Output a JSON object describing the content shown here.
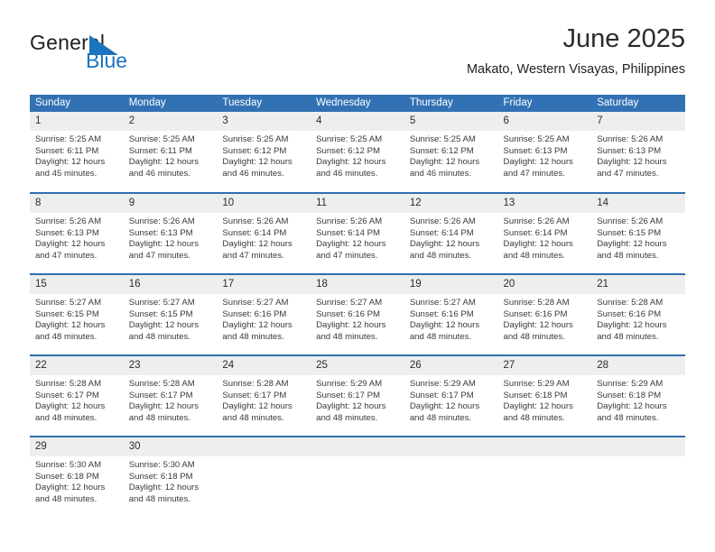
{
  "logo": {
    "text_primary": "General",
    "text_secondary": "Blue",
    "triangle_color": "#1e73be",
    "primary_color": "#231f20",
    "secondary_color": "#1e73be"
  },
  "header": {
    "title": "June 2025",
    "subtitle": "Makato, Western Visayas, Philippines"
  },
  "theme": {
    "header_blue": "#3272b4",
    "separator_blue": "#2f6fae",
    "day_band_gray": "#eeeeee",
    "text_dark": "#2b2b2b",
    "text_body": "#3a3a3a"
  },
  "calendar": {
    "weekday_headers": [
      "Sunday",
      "Monday",
      "Tuesday",
      "Wednesday",
      "Thursday",
      "Friday",
      "Saturday"
    ],
    "weeks": [
      [
        {
          "day": "1",
          "sunrise": "Sunrise: 5:25 AM",
          "sunset": "Sunset: 6:11 PM",
          "daylight_line1": "Daylight: 12 hours",
          "daylight_line2": "and 45 minutes."
        },
        {
          "day": "2",
          "sunrise": "Sunrise: 5:25 AM",
          "sunset": "Sunset: 6:11 PM",
          "daylight_line1": "Daylight: 12 hours",
          "daylight_line2": "and 46 minutes."
        },
        {
          "day": "3",
          "sunrise": "Sunrise: 5:25 AM",
          "sunset": "Sunset: 6:12 PM",
          "daylight_line1": "Daylight: 12 hours",
          "daylight_line2": "and 46 minutes."
        },
        {
          "day": "4",
          "sunrise": "Sunrise: 5:25 AM",
          "sunset": "Sunset: 6:12 PM",
          "daylight_line1": "Daylight: 12 hours",
          "daylight_line2": "and 46 minutes."
        },
        {
          "day": "5",
          "sunrise": "Sunrise: 5:25 AM",
          "sunset": "Sunset: 6:12 PM",
          "daylight_line1": "Daylight: 12 hours",
          "daylight_line2": "and 46 minutes."
        },
        {
          "day": "6",
          "sunrise": "Sunrise: 5:25 AM",
          "sunset": "Sunset: 6:13 PM",
          "daylight_line1": "Daylight: 12 hours",
          "daylight_line2": "and 47 minutes."
        },
        {
          "day": "7",
          "sunrise": "Sunrise: 5:26 AM",
          "sunset": "Sunset: 6:13 PM",
          "daylight_line1": "Daylight: 12 hours",
          "daylight_line2": "and 47 minutes."
        }
      ],
      [
        {
          "day": "8",
          "sunrise": "Sunrise: 5:26 AM",
          "sunset": "Sunset: 6:13 PM",
          "daylight_line1": "Daylight: 12 hours",
          "daylight_line2": "and 47 minutes."
        },
        {
          "day": "9",
          "sunrise": "Sunrise: 5:26 AM",
          "sunset": "Sunset: 6:13 PM",
          "daylight_line1": "Daylight: 12 hours",
          "daylight_line2": "and 47 minutes."
        },
        {
          "day": "10",
          "sunrise": "Sunrise: 5:26 AM",
          "sunset": "Sunset: 6:14 PM",
          "daylight_line1": "Daylight: 12 hours",
          "daylight_line2": "and 47 minutes."
        },
        {
          "day": "11",
          "sunrise": "Sunrise: 5:26 AM",
          "sunset": "Sunset: 6:14 PM",
          "daylight_line1": "Daylight: 12 hours",
          "daylight_line2": "and 47 minutes."
        },
        {
          "day": "12",
          "sunrise": "Sunrise: 5:26 AM",
          "sunset": "Sunset: 6:14 PM",
          "daylight_line1": "Daylight: 12 hours",
          "daylight_line2": "and 48 minutes."
        },
        {
          "day": "13",
          "sunrise": "Sunrise: 5:26 AM",
          "sunset": "Sunset: 6:14 PM",
          "daylight_line1": "Daylight: 12 hours",
          "daylight_line2": "and 48 minutes."
        },
        {
          "day": "14",
          "sunrise": "Sunrise: 5:26 AM",
          "sunset": "Sunset: 6:15 PM",
          "daylight_line1": "Daylight: 12 hours",
          "daylight_line2": "and 48 minutes."
        }
      ],
      [
        {
          "day": "15",
          "sunrise": "Sunrise: 5:27 AM",
          "sunset": "Sunset: 6:15 PM",
          "daylight_line1": "Daylight: 12 hours",
          "daylight_line2": "and 48 minutes."
        },
        {
          "day": "16",
          "sunrise": "Sunrise: 5:27 AM",
          "sunset": "Sunset: 6:15 PM",
          "daylight_line1": "Daylight: 12 hours",
          "daylight_line2": "and 48 minutes."
        },
        {
          "day": "17",
          "sunrise": "Sunrise: 5:27 AM",
          "sunset": "Sunset: 6:16 PM",
          "daylight_line1": "Daylight: 12 hours",
          "daylight_line2": "and 48 minutes."
        },
        {
          "day": "18",
          "sunrise": "Sunrise: 5:27 AM",
          "sunset": "Sunset: 6:16 PM",
          "daylight_line1": "Daylight: 12 hours",
          "daylight_line2": "and 48 minutes."
        },
        {
          "day": "19",
          "sunrise": "Sunrise: 5:27 AM",
          "sunset": "Sunset: 6:16 PM",
          "daylight_line1": "Daylight: 12 hours",
          "daylight_line2": "and 48 minutes."
        },
        {
          "day": "20",
          "sunrise": "Sunrise: 5:28 AM",
          "sunset": "Sunset: 6:16 PM",
          "daylight_line1": "Daylight: 12 hours",
          "daylight_line2": "and 48 minutes."
        },
        {
          "day": "21",
          "sunrise": "Sunrise: 5:28 AM",
          "sunset": "Sunset: 6:16 PM",
          "daylight_line1": "Daylight: 12 hours",
          "daylight_line2": "and 48 minutes."
        }
      ],
      [
        {
          "day": "22",
          "sunrise": "Sunrise: 5:28 AM",
          "sunset": "Sunset: 6:17 PM",
          "daylight_line1": "Daylight: 12 hours",
          "daylight_line2": "and 48 minutes."
        },
        {
          "day": "23",
          "sunrise": "Sunrise: 5:28 AM",
          "sunset": "Sunset: 6:17 PM",
          "daylight_line1": "Daylight: 12 hours",
          "daylight_line2": "and 48 minutes."
        },
        {
          "day": "24",
          "sunrise": "Sunrise: 5:28 AM",
          "sunset": "Sunset: 6:17 PM",
          "daylight_line1": "Daylight: 12 hours",
          "daylight_line2": "and 48 minutes."
        },
        {
          "day": "25",
          "sunrise": "Sunrise: 5:29 AM",
          "sunset": "Sunset: 6:17 PM",
          "daylight_line1": "Daylight: 12 hours",
          "daylight_line2": "and 48 minutes."
        },
        {
          "day": "26",
          "sunrise": "Sunrise: 5:29 AM",
          "sunset": "Sunset: 6:17 PM",
          "daylight_line1": "Daylight: 12 hours",
          "daylight_line2": "and 48 minutes."
        },
        {
          "day": "27",
          "sunrise": "Sunrise: 5:29 AM",
          "sunset": "Sunset: 6:18 PM",
          "daylight_line1": "Daylight: 12 hours",
          "daylight_line2": "and 48 minutes."
        },
        {
          "day": "28",
          "sunrise": "Sunrise: 5:29 AM",
          "sunset": "Sunset: 6:18 PM",
          "daylight_line1": "Daylight: 12 hours",
          "daylight_line2": "and 48 minutes."
        }
      ],
      [
        {
          "day": "29",
          "sunrise": "Sunrise: 5:30 AM",
          "sunset": "Sunset: 6:18 PM",
          "daylight_line1": "Daylight: 12 hours",
          "daylight_line2": "and 48 minutes."
        },
        {
          "day": "30",
          "sunrise": "Sunrise: 5:30 AM",
          "sunset": "Sunset: 6:18 PM",
          "daylight_line1": "Daylight: 12 hours",
          "daylight_line2": "and 48 minutes."
        },
        {
          "day": "",
          "sunrise": "",
          "sunset": "",
          "daylight_line1": "",
          "daylight_line2": ""
        },
        {
          "day": "",
          "sunrise": "",
          "sunset": "",
          "daylight_line1": "",
          "daylight_line2": ""
        },
        {
          "day": "",
          "sunrise": "",
          "sunset": "",
          "daylight_line1": "",
          "daylight_line2": ""
        },
        {
          "day": "",
          "sunrise": "",
          "sunset": "",
          "daylight_line1": "",
          "daylight_line2": ""
        },
        {
          "day": "",
          "sunrise": "",
          "sunset": "",
          "daylight_line1": "",
          "daylight_line2": ""
        }
      ]
    ]
  }
}
